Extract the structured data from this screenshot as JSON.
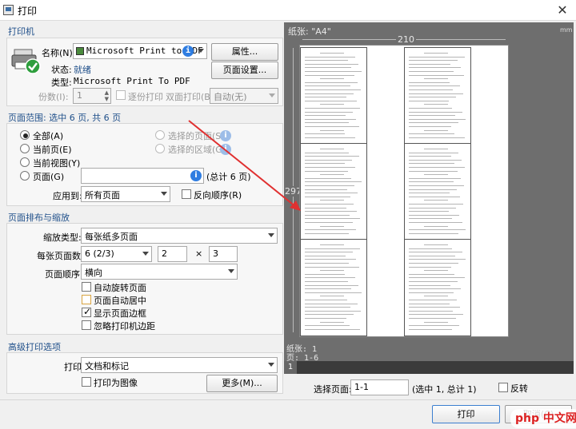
{
  "window": {
    "title": "打印",
    "close": "✕"
  },
  "printer": {
    "section": "打印机",
    "name_label": "名称(N):",
    "name_value": "Microsoft Print to PDF",
    "status_label": "状态:",
    "status_value": "就绪",
    "type_label": "类型:",
    "type_value": "Microsoft Print To PDF",
    "properties_button": "属性...",
    "page_setup_button": "页面设置...",
    "copies_label": "份数(I):",
    "copies_value": "1",
    "collate_label": "逐份打印",
    "duplex_label": "双面打印(B):",
    "duplex_value": "自动(无)"
  },
  "range": {
    "section": "页面范围: 选中 6 页, 共 6 页",
    "all": "全部(A)",
    "current": "当前页(E)",
    "current_view": "当前视图(Y)",
    "pages": "页面(G)",
    "selected_pages": "选择的页面(S)",
    "selected_region": "选择的区域(G)",
    "pages_total": "(总计 6 页)",
    "apply_label": "应用到:",
    "apply_value": "所有页面",
    "reverse_label": "反向顺序(R)"
  },
  "layout": {
    "section": "页面排布与缩放",
    "scale_type_label": "缩放类型:",
    "scale_type_value": "每张纸多页面",
    "pages_per_sheet_label": "每张页面数:",
    "pages_per_sheet_value": "6 (2/3)",
    "cols": "2",
    "times": "×",
    "rows": "3",
    "order_label": "页面顺序:",
    "order_value": "横向",
    "auto_rotate": "自动旋转页面",
    "auto_center": "页面自动居中",
    "show_border": "显示页面边框",
    "ignore_margin": "忽略打印机边距"
  },
  "advanced": {
    "section": "高级打印选项",
    "print_label": "打印",
    "print_value": "文档和标记",
    "print_as_image": "打印为图像",
    "more_button": "更多(M)..."
  },
  "preview": {
    "paper_label": "纸张: \"A4\"",
    "units": "mm",
    "width": "210",
    "height": "297",
    "sheet_info": "纸张: 1",
    "pages_info": "页: 1-6",
    "sheet_number": "1",
    "select_page_label": "选择页面:",
    "select_page_value": "1-1",
    "select_info": "(选中 1, 总计 1)",
    "reverse_label": "反转"
  },
  "footer": {
    "print_button": "打印",
    "cancel_button": "取消(C)",
    "watermark": "php 中文网"
  }
}
